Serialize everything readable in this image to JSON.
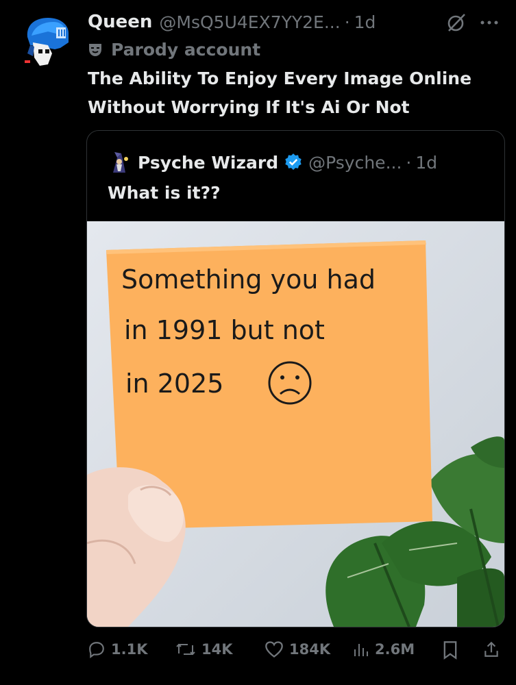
{
  "tweet": {
    "name": "Queen",
    "handle": "@MsQ5U4EX7YY2E...",
    "separator": "·",
    "time": "1d",
    "label": "Parody account",
    "text_line1": "The Ability To Enjoy Every Image Online",
    "text_line2": "Without Worrying If It's Ai Or Not"
  },
  "quoted": {
    "name": "Psyche Wizard",
    "handle": "@Psyche...",
    "separator": "·",
    "time": "1d",
    "text": "What is it??",
    "note": {
      "line1": "Something you had",
      "line2": "in 1991 but not",
      "line3": "in 2025"
    }
  },
  "actions": {
    "replies": "1.1K",
    "reposts": "14K",
    "likes": "184K",
    "views": "2.6M"
  },
  "colors": {
    "accent": "#1d9bf0",
    "muted": "#71767b",
    "note": "#fdb15d",
    "border": "#2f3336"
  },
  "icons": [
    "grok-icon",
    "more-icon",
    "parody-mask-icon",
    "verified-badge-icon",
    "reply-icon",
    "repost-icon",
    "like-icon",
    "views-icon",
    "bookmark-icon",
    "share-icon"
  ]
}
